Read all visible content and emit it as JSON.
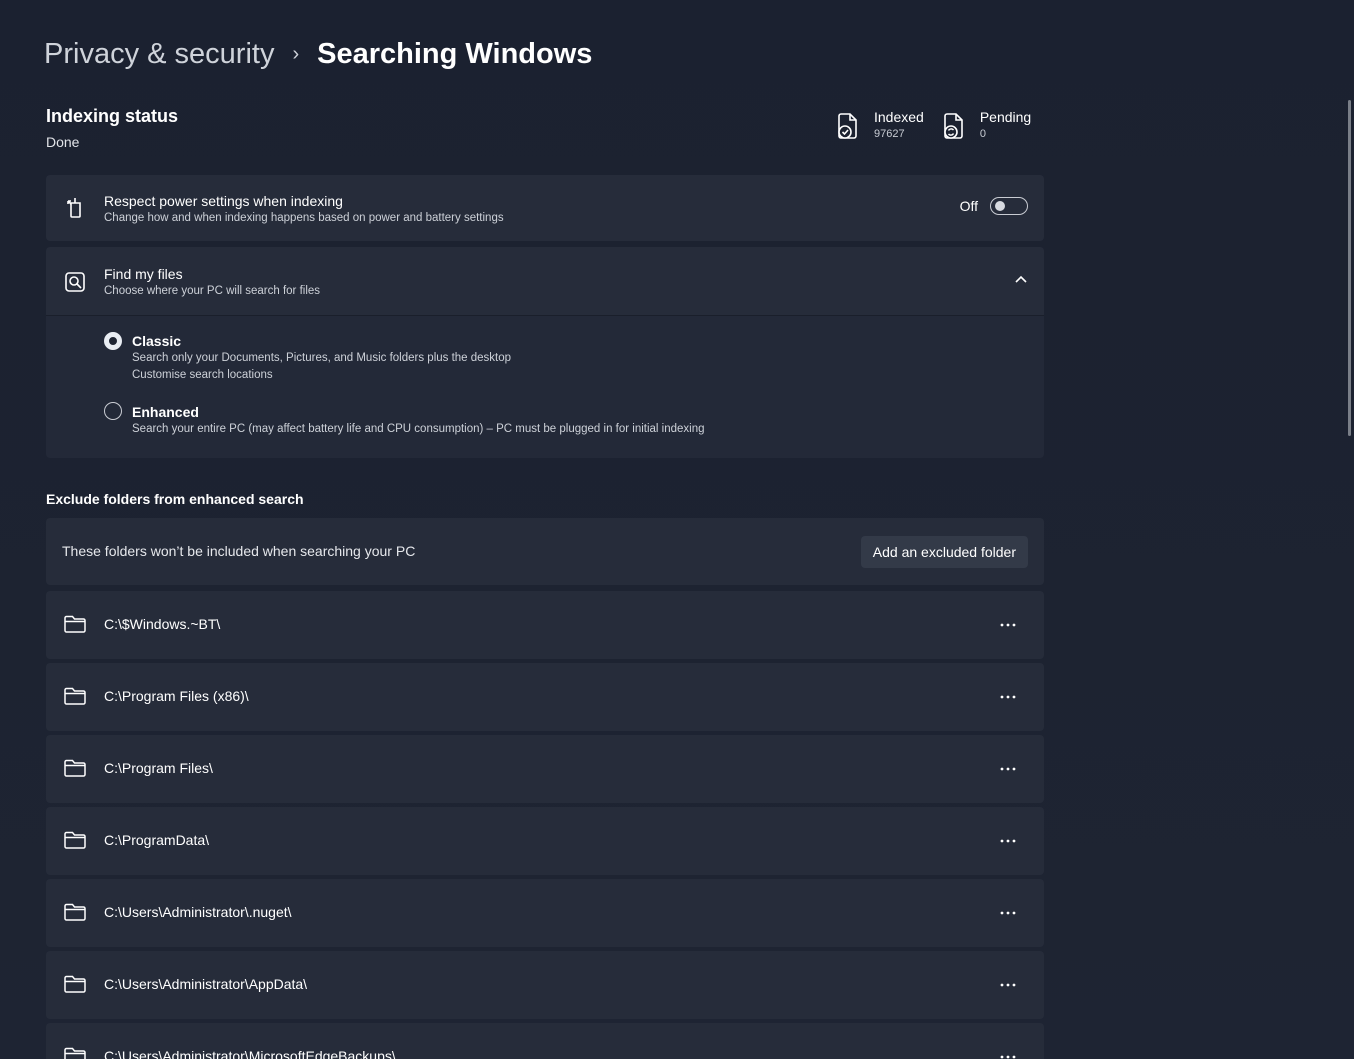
{
  "breadcrumb": {
    "parent": "Privacy & security",
    "separator": "›",
    "current": "Searching Windows"
  },
  "indexing": {
    "title": "Indexing status",
    "status": "Done",
    "indexed_label": "Indexed",
    "indexed_count": "97627",
    "pending_label": "Pending",
    "pending_count": "0"
  },
  "power": {
    "title": "Respect power settings when indexing",
    "subtitle": "Change how and when indexing happens based on power and battery settings",
    "toggle_label": "Off",
    "toggle_on": false
  },
  "find_files": {
    "title": "Find my files",
    "subtitle": "Choose where your PC will search for files",
    "expanded": true,
    "options": [
      {
        "title": "Classic",
        "desc": "Search only your Documents, Pictures, and Music folders plus the desktop",
        "link": "Customise search locations",
        "selected": true
      },
      {
        "title": "Enhanced",
        "desc": "Search your entire PC (may affect battery life and CPU consumption) – PC must be plugged in for initial indexing",
        "selected": false
      }
    ]
  },
  "exclude": {
    "heading": "Exclude folders from enhanced search",
    "info": "These folders won’t be included when searching your PC",
    "add_button": "Add an excluded folder",
    "more_icon": "more-horizontal-icon",
    "folders": [
      "C:\\$Windows.~BT\\",
      "C:\\Program Files (x86)\\",
      "C:\\Program Files\\",
      "C:\\ProgramData\\",
      "C:\\Users\\Administrator\\.nuget\\",
      "C:\\Users\\Administrator\\AppData\\",
      "C:\\Users\\Administrator\\MicrosoftEdgeBackups\\"
    ]
  },
  "colors": {
    "background": "#1c2230",
    "card": "#262c3a",
    "text": "#ffffff"
  }
}
